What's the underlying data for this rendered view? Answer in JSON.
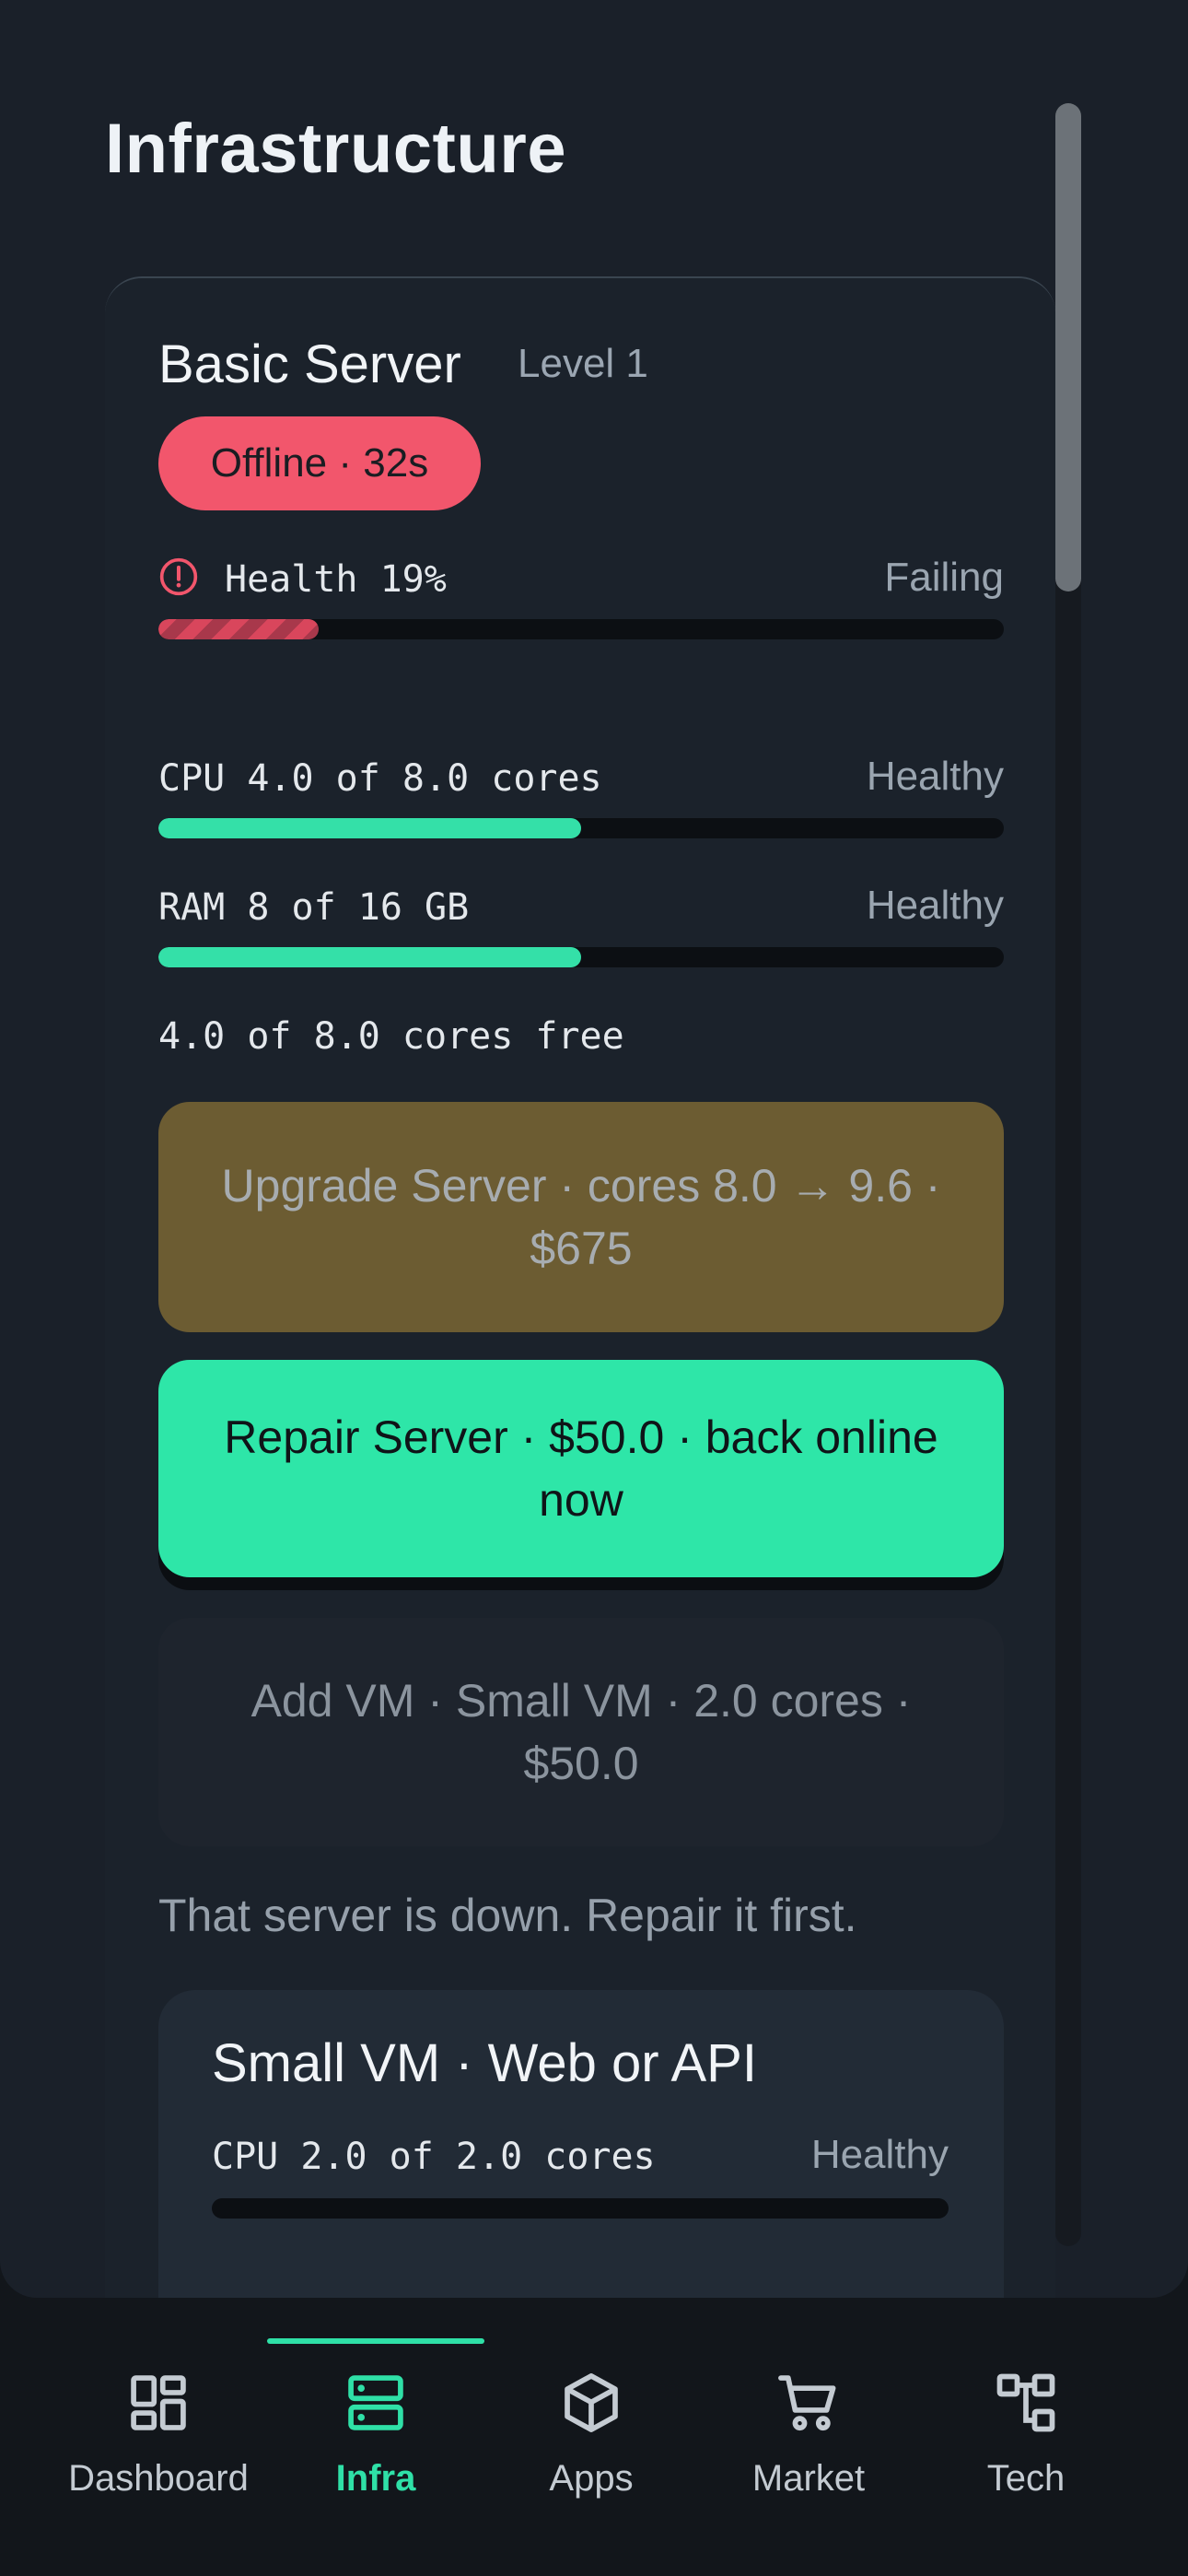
{
  "page": {
    "title": "Infrastructure"
  },
  "server": {
    "name": "Basic Server",
    "level": "Level 1",
    "status": "Offline · 32s",
    "health": {
      "label": "Health 19%",
      "state": "Failing",
      "percent": 19
    },
    "cpu": {
      "label": "CPU 4.0 of 8.0 cores",
      "state": "Healthy",
      "used": 4.0,
      "total": 8.0
    },
    "ram": {
      "label": "RAM 8 of 16 GB",
      "state": "Healthy",
      "used": 8,
      "total": 16
    },
    "free": "4.0 of 8.0 cores free",
    "actions": {
      "upgrade": "Upgrade Server · cores 8.0 → 9.6 · $675",
      "repair": "Repair Server · $50.0 · back online now",
      "add_vm": "Add VM · Small VM · 2.0 cores · $50.0"
    },
    "warning": "That server is down. Repair it first."
  },
  "vm": {
    "title": "Small VM · Web or API",
    "cpu": {
      "label": "CPU 2.0 of 2.0 cores",
      "state": "Healthy",
      "used": 0,
      "total": 2.0
    }
  },
  "nav": {
    "active": "Infra",
    "items": [
      {
        "label": "Dashboard",
        "icon": "dashboard-icon"
      },
      {
        "label": "Infra",
        "icon": "server-icon"
      },
      {
        "label": "Apps",
        "icon": "cube-icon"
      },
      {
        "label": "Market",
        "icon": "cart-icon"
      },
      {
        "label": "Tech",
        "icon": "tech-tree-icon"
      }
    ]
  },
  "colors": {
    "accent": "#2fe0a7",
    "danger": "#f2566c",
    "upgrade": "#6c5c32",
    "background": "#1a2029"
  }
}
